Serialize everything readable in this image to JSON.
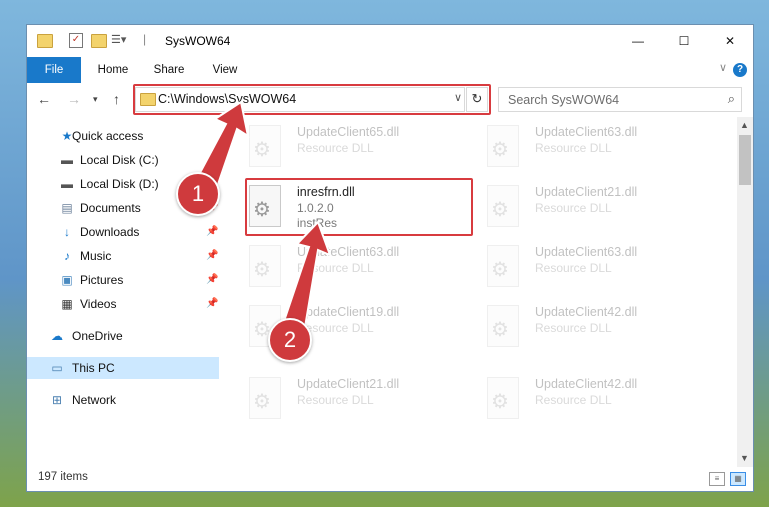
{
  "window": {
    "title": "SysWOW64",
    "controls": {
      "minimize": "—",
      "maximize": "☐",
      "close": "✕"
    }
  },
  "ribbon": {
    "tabs": [
      "File",
      "Home",
      "Share",
      "View"
    ],
    "help": "?"
  },
  "nav": {
    "path": "C:\\Windows\\SysWOW64",
    "search_placeholder": "Search SysWOW64"
  },
  "sidebar": {
    "items": [
      {
        "label": "Quick access",
        "icon": "star-icon"
      },
      {
        "label": "Local Disk (C:)",
        "icon": "drive-icon"
      },
      {
        "label": "Local Disk (D:)",
        "icon": "drive-icon"
      },
      {
        "label": "Documents",
        "icon": "documents-icon"
      },
      {
        "label": "Downloads",
        "icon": "download-icon"
      },
      {
        "label": "Music",
        "icon": "music-icon"
      },
      {
        "label": "Pictures",
        "icon": "pictures-icon"
      },
      {
        "label": "Videos",
        "icon": "videos-icon"
      },
      {
        "label": "OneDrive",
        "icon": "cloud-icon"
      },
      {
        "label": "This PC",
        "icon": "computer-icon",
        "selected": true
      },
      {
        "label": "Network",
        "icon": "network-icon"
      }
    ]
  },
  "files": [
    {
      "name": "UpdateClient65.dll",
      "desc": "Resource DLL",
      "faded": true
    },
    {
      "name": "UpdateClient63.dll",
      "desc": "Resource DLL",
      "faded": true
    },
    {
      "name": "inresfrn.dll",
      "desc": "1.0.2.0",
      "extra": "instRes",
      "faded": false,
      "highlight": true
    },
    {
      "name": "UpdateClient21.dll",
      "desc": "Resource DLL",
      "faded": true
    },
    {
      "name": "UpdateClient63.dll",
      "desc": "Resource DLL",
      "faded": true
    },
    {
      "name": "UpdateClient63.dll",
      "desc": "Resource DLL",
      "faded": true
    },
    {
      "name": "UpdateClient19.dll",
      "desc": "Resource DLL",
      "faded": true
    },
    {
      "name": "UpdateClient42.dll",
      "desc": "Resource DLL",
      "faded": true
    },
    {
      "name": "UpdateClient21.dll",
      "desc": "Resource DLL",
      "faded": true
    },
    {
      "name": "UpdateClient42.dll",
      "desc": "Resource DLL",
      "faded": true
    }
  ],
  "status": {
    "count": "197 items"
  },
  "callouts": [
    "1",
    "2"
  ],
  "colors": {
    "accent": "#1979ca",
    "highlight": "#d83b3f",
    "selected": "#cce8ff"
  }
}
